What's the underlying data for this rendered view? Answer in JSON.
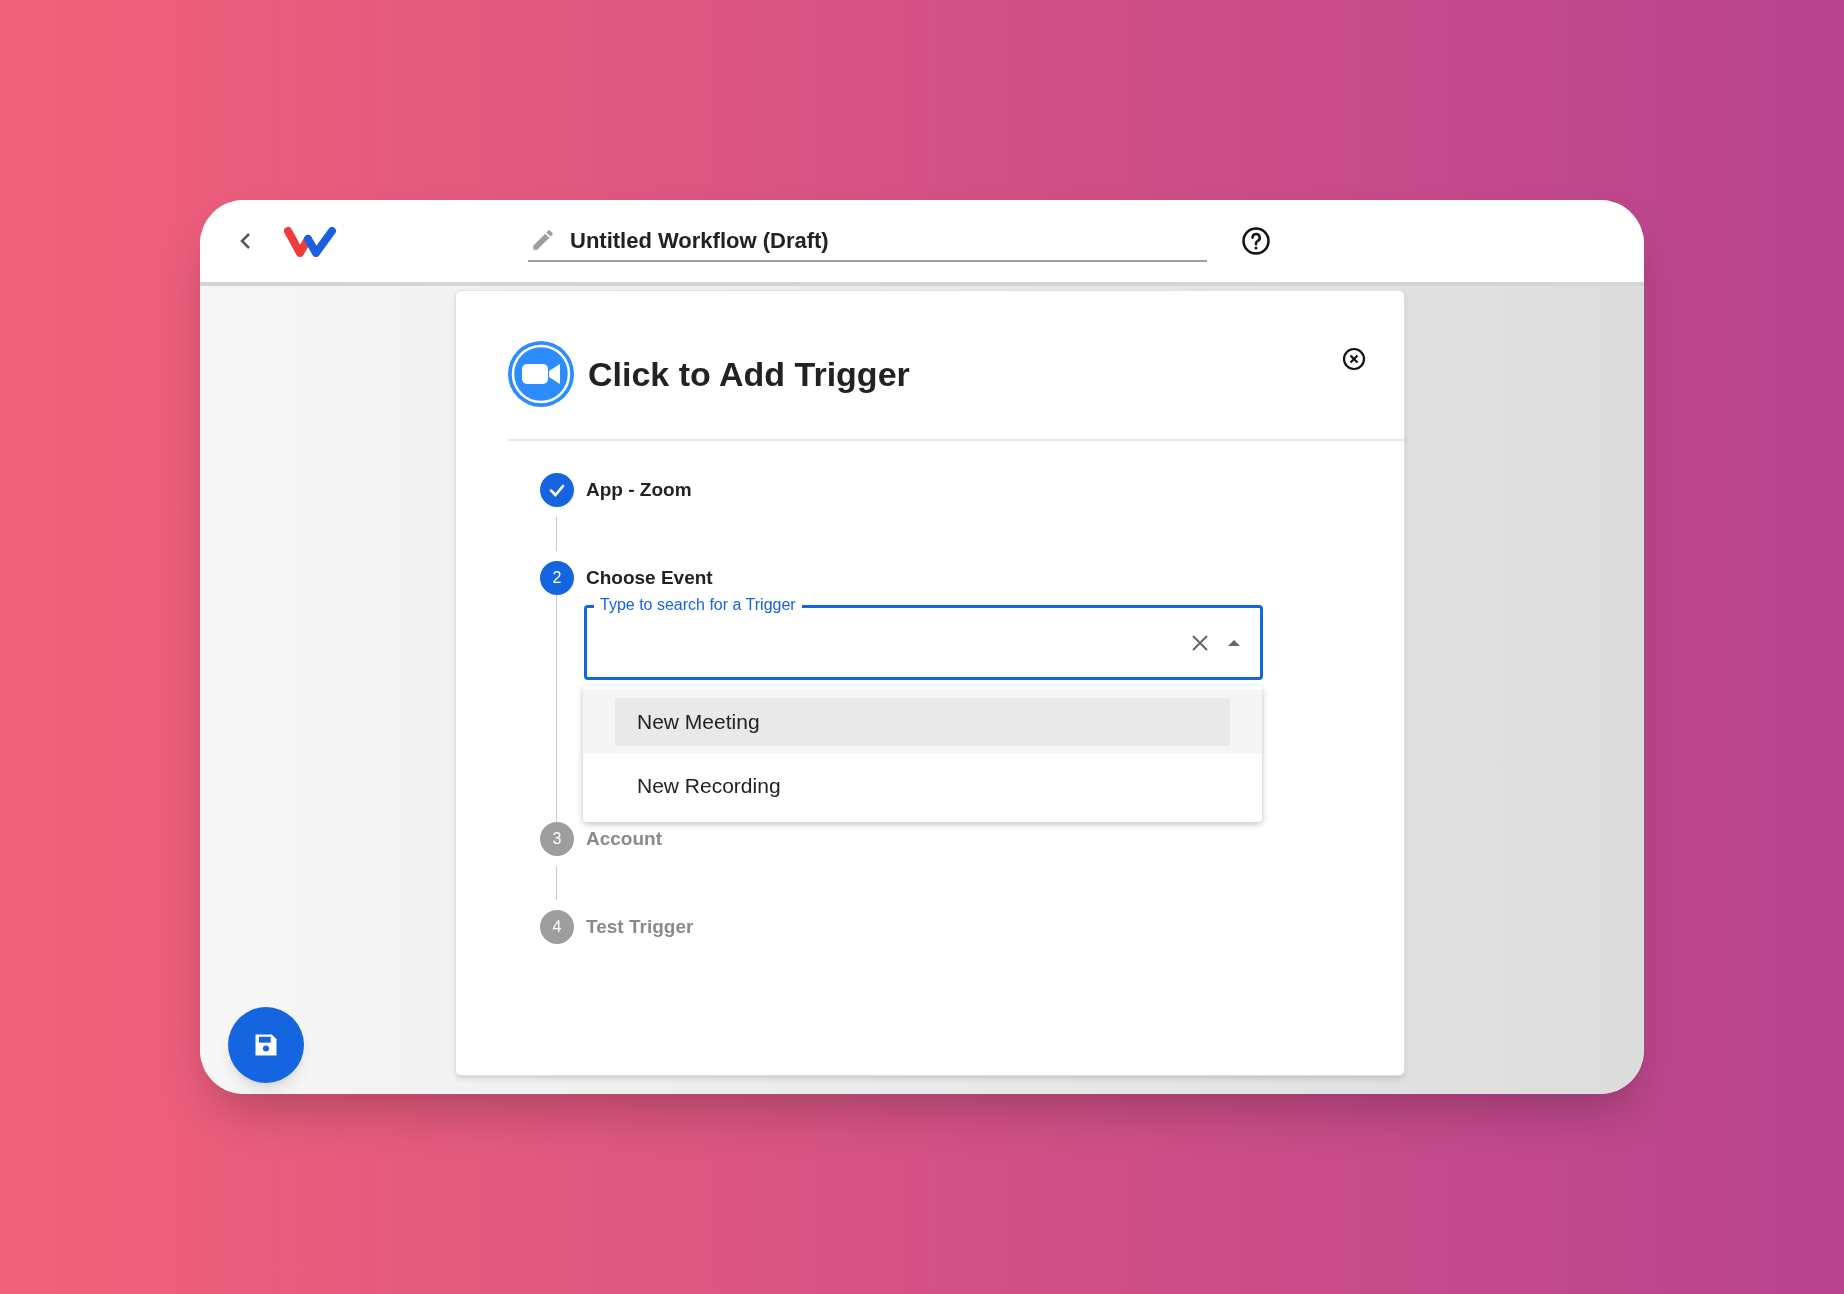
{
  "header": {
    "title": "Untitled Workflow (Draft)"
  },
  "dialog": {
    "title": "Click to Add Trigger",
    "steps": [
      {
        "label": "App - Zoom",
        "done": true,
        "active": false
      },
      {
        "number": "2",
        "label": "Choose Event",
        "done": false,
        "active": true
      },
      {
        "number": "3",
        "label": "Account",
        "done": false,
        "active": false
      },
      {
        "number": "4",
        "label": "Test Trigger",
        "done": false,
        "active": false
      }
    ],
    "search": {
      "placeholder": "Type to search for a Trigger"
    },
    "options": [
      {
        "label": "New Meeting",
        "selected": true
      },
      {
        "label": "New Recording",
        "selected": false
      }
    ]
  }
}
